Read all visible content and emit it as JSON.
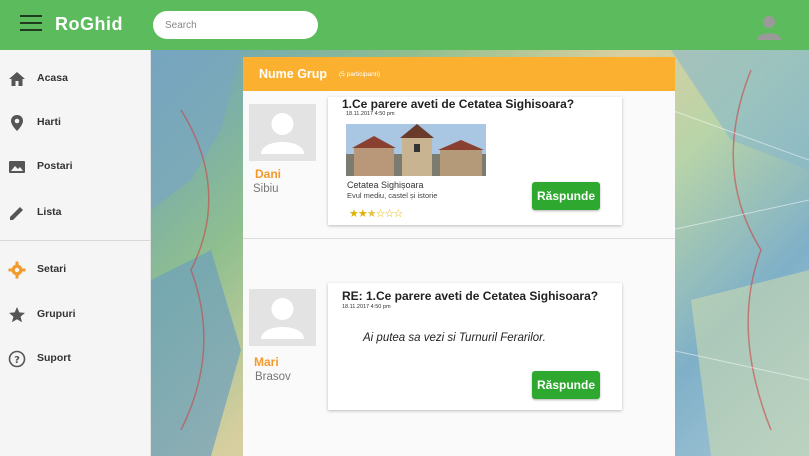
{
  "app": {
    "brand": "RoGhid"
  },
  "search": {
    "placeholder": "Search"
  },
  "sidebar": {
    "items": [
      {
        "label": "Acasa",
        "icon": "home-icon"
      },
      {
        "label": "Harti",
        "icon": "map-pin-icon"
      },
      {
        "label": "Postari",
        "icon": "image-icon"
      },
      {
        "label": "Lista",
        "icon": "pencil-icon"
      },
      {
        "label": "Setari",
        "icon": "gear-icon"
      },
      {
        "label": "Grupuri",
        "icon": "star-icon"
      },
      {
        "label": "Suport",
        "icon": "help-icon"
      }
    ]
  },
  "group": {
    "name": "Nume Grup",
    "participants": "(5 participanti)"
  },
  "messages": [
    {
      "user": "Dani",
      "city": "Sibiu",
      "title": "1.Ce parere aveti de Cetatea Sighisoara?",
      "time": "18.11.2017 4:50 pm",
      "preview_title": "Cetatea Sighișoara",
      "preview_desc": "Evul mediu, castel și istorie",
      "rating": 2.5,
      "rating_max": 5,
      "reply_label": "Răspunde"
    },
    {
      "user": "Mari",
      "city": "Brasov",
      "title": "RE: 1.Ce parere aveti de Cetatea Sighisoara?",
      "time": "18.11.2017 4:50 pm",
      "body": "Ai putea sa vezi si Turnuril Ferarilor.",
      "reply_label": "Răspunde"
    }
  ],
  "colors": {
    "topbar": "#5cbb5c",
    "header": "#fbb02f",
    "button": "#2ea82e",
    "username": "#f39a2e"
  }
}
